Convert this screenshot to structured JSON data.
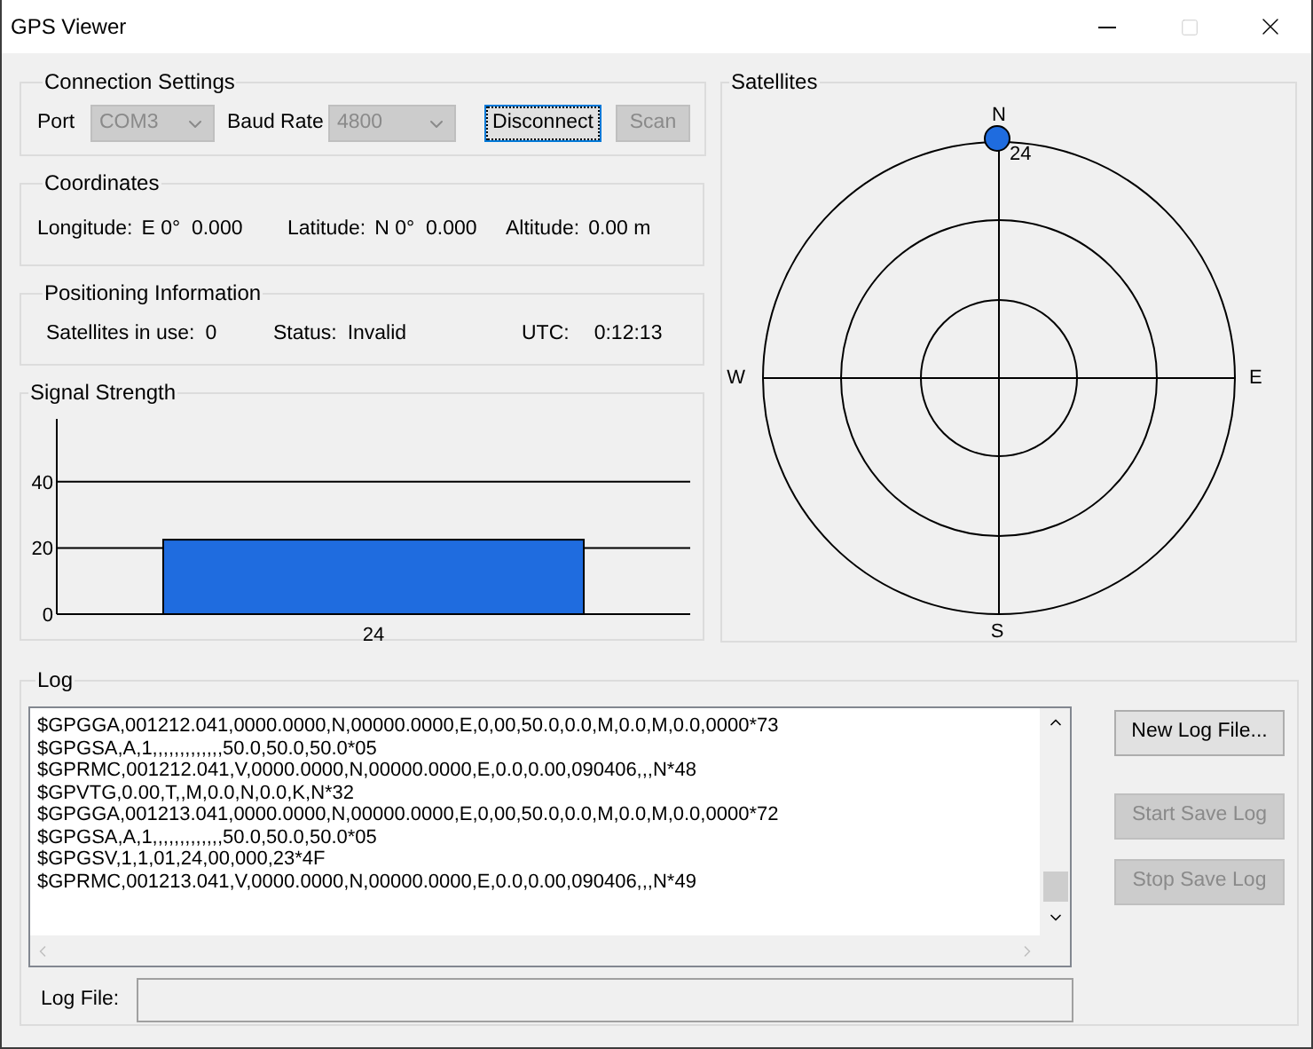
{
  "window": {
    "title": "GPS Viewer"
  },
  "connection_settings": {
    "title": "Connection Settings",
    "port": {
      "label": "Port",
      "value": "COM3",
      "disabled": true
    },
    "baud_rate": {
      "label": "Baud Rate",
      "value": "4800",
      "disabled": true
    },
    "buttons": [
      {
        "label": "Disconnect",
        "disabled": false,
        "focused": true
      },
      {
        "label": "Scan",
        "disabled": true,
        "focused": false
      }
    ]
  },
  "coordinates": {
    "title": "Coordinates",
    "fields": [
      {
        "label": "Longitude:",
        "value": "E 0°  0.000"
      },
      {
        "label": "Latitude:",
        "value": "N 0°  0.000"
      },
      {
        "label": "Altitude:",
        "value": "0.00 m"
      }
    ]
  },
  "positioning": {
    "title": "Positioning Information",
    "fields": [
      {
        "label": "Satellites in use:",
        "value": "0"
      },
      {
        "label": "Status:",
        "value": "Invalid"
      },
      {
        "label": "UTC:",
        "value": "0:12:13"
      }
    ]
  },
  "signal_strength": {
    "title": "Signal Strength",
    "chart_data": {
      "type": "bar",
      "categories": [
        "24"
      ],
      "series": [
        {
          "color": "#1f6cdf",
          "values": [
            22.5
          ]
        }
      ],
      "ylim": [
        0,
        59
      ],
      "yticks": [
        0,
        20,
        40
      ]
    }
  },
  "satellites": {
    "title": "Satellites",
    "directions": [
      "N",
      "E",
      "S",
      "W"
    ],
    "items": [
      {
        "label": "24",
        "color": "#1f6cdf"
      }
    ]
  },
  "log": {
    "title": "Log",
    "lines": [
      "$GPGGA,001212.041,0000.0000,N,00000.0000,E,0,00,50.0,0.0,M,0.0,M,0.0,0000*73",
      "$GPGSA,A,1,,,,,,,,,,,,,50.0,50.0,50.0*05",
      "$GPRMC,001212.041,V,0000.0000,N,00000.0000,E,0.0,0.00,090406,,,N*48",
      "$GPVTG,0.00,T,,M,0.0,N,0.0,K,N*32",
      "$GPGGA,001213.041,0000.0000,N,00000.0000,E,0,00,50.0,0.0,M,0.0,M,0.0,0000*72",
      "$GPGSA,A,1,,,,,,,,,,,,,50.0,50.0,50.0*05",
      "$GPGSV,1,1,01,24,00,000,23*4F",
      "$GPRMC,001213.041,V,0000.0000,N,00000.0000,E,0.0,0.00,090406,,,N*49"
    ],
    "log_file": {
      "label": "Log File:"
    },
    "buttons": [
      {
        "label": "New Log File...",
        "disabled": false
      },
      {
        "label": "Start Save Log",
        "disabled": true
      },
      {
        "label": "Stop Save Log",
        "disabled": true
      }
    ]
  }
}
